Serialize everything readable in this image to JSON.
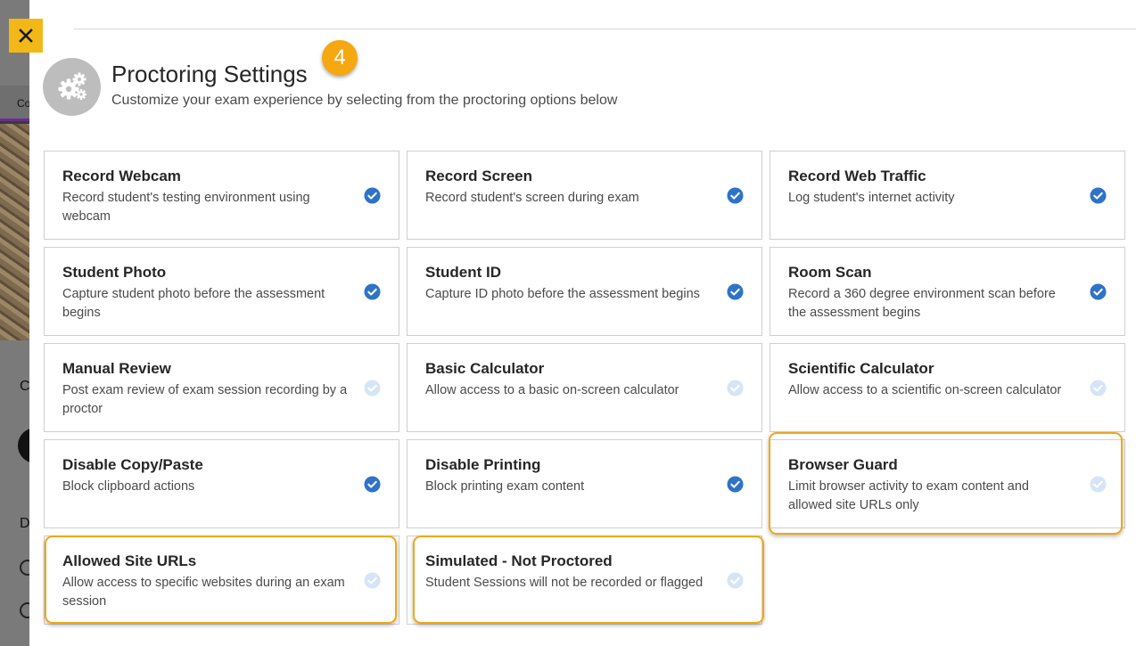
{
  "colors": {
    "accent": "#f2b818",
    "badge": "#f5a80f",
    "check_on": "#2e73c7",
    "check_off": "#d6e5f5",
    "highlight": "#f0a818"
  },
  "background": {
    "tab_fragment": "Co",
    "c_fragment": "C",
    "d_fragment": "D"
  },
  "header": {
    "title": "Proctoring Settings",
    "subtitle": "Customize your exam experience by selecting from the proctoring options below",
    "step_badge": "4",
    "icon": "gears-icon",
    "close_icon": "close-icon"
  },
  "options": [
    {
      "title": "Record Webcam",
      "description": "Record student's testing environment using webcam",
      "checked": true,
      "highlighted": false
    },
    {
      "title": "Record Screen",
      "description": "Record student's screen during exam",
      "checked": true,
      "highlighted": false
    },
    {
      "title": "Record Web Traffic",
      "description": "Log student's internet activity",
      "checked": true,
      "highlighted": false
    },
    {
      "title": "Student Photo",
      "description": "Capture student photo before the assessment begins",
      "checked": true,
      "highlighted": false
    },
    {
      "title": "Student ID",
      "description": "Capture ID photo before the assessment begins",
      "checked": true,
      "highlighted": false
    },
    {
      "title": "Room Scan",
      "description": "Record a 360 degree environment scan before the assessment begins",
      "checked": true,
      "highlighted": false
    },
    {
      "title": "Manual Review",
      "description": "Post exam review of exam session recording by a proctor",
      "checked": false,
      "highlighted": false
    },
    {
      "title": "Basic Calculator",
      "description": "Allow access to a basic on-screen calculator",
      "checked": false,
      "highlighted": false
    },
    {
      "title": "Scientific Calculator",
      "description": "Allow access to a scientific on-screen calculator",
      "checked": false,
      "highlighted": false
    },
    {
      "title": "Disable Copy/Paste",
      "description": "Block clipboard actions",
      "checked": true,
      "highlighted": false
    },
    {
      "title": "Disable Printing",
      "description": "Block printing exam content",
      "checked": true,
      "highlighted": false
    },
    {
      "title": "Browser Guard",
      "description": "Limit browser activity to exam content and allowed site URLs only",
      "checked": false,
      "highlighted": true
    },
    {
      "title": "Allowed Site URLs",
      "description": "Allow access to specific websites during an exam session",
      "checked": false,
      "highlighted": true
    },
    {
      "title": "Simulated - Not Proctored",
      "description": "Student Sessions will not be recorded or flagged",
      "checked": false,
      "highlighted": true
    }
  ]
}
